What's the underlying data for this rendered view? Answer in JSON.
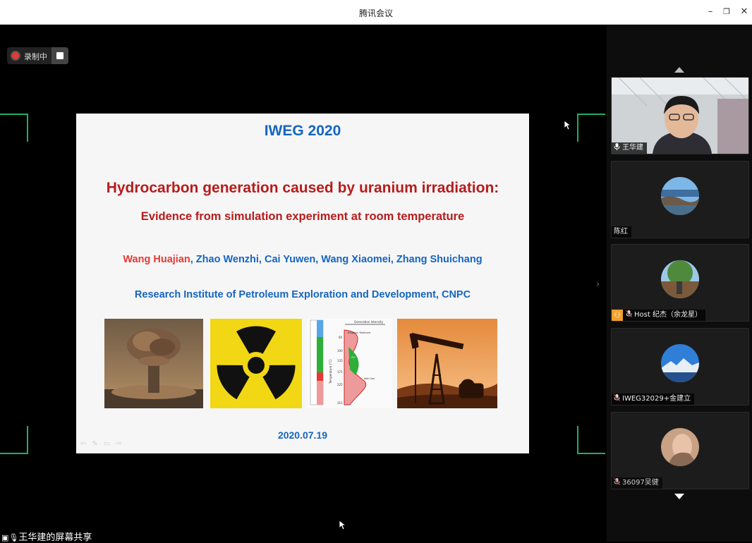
{
  "window": {
    "title": "腾讯会议",
    "minimize_icon": "minimize-icon",
    "restore_icon": "restore-icon",
    "close_icon": "close-icon"
  },
  "recording": {
    "label": "录制中"
  },
  "slide": {
    "event": "IWEG 2020",
    "title": "Hydrocarbon generation caused by uranium irradiation:",
    "subtitle": "Evidence from simulation experiment at room temperature",
    "first_author": "Wang Huajian",
    "other_authors": ", Zhao Wenzhi, Cai Yuwen, Wang Xiaomei, Zhang Shuichang",
    "institution": "Research Institute of Petroleum Exploration and Development, CNPC",
    "date": "2020.07.19",
    "diagram": {
      "top_label": "Generation Intensity",
      "axis_label": "Temperature (°C)",
      "ticks": [
        "60",
        "100",
        "135",
        "175",
        "225",
        "315"
      ],
      "zone_labels": [
        "Biogenic Methane",
        "Oil",
        "Wet Gas"
      ]
    }
  },
  "participants": [
    {
      "name": "王华建",
      "type": "video"
    },
    {
      "name": "陈红",
      "type": "avatar"
    },
    {
      "name": "Host 纪杰（余龙星）",
      "type": "avatar",
      "host": true
    },
    {
      "name": "IWEG32029+金建立",
      "type": "avatar"
    },
    {
      "name": "36097吴健",
      "type": "avatar"
    }
  ],
  "share_status": "王华建的屏幕共享",
  "colors": {
    "accent_green": "#1fae6a",
    "slide_blue": "#1565c0",
    "slide_red": "#b71c1c"
  }
}
